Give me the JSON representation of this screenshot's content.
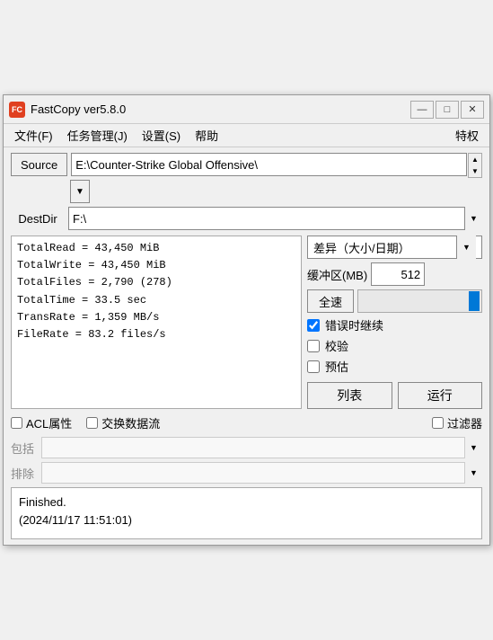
{
  "window": {
    "title": "FastCopy ver5.8.0",
    "icon_text": "FC",
    "min_btn": "—",
    "max_btn": "□",
    "close_btn": "✕"
  },
  "menu": {
    "file": "文件(F)",
    "task": "任务管理(J)",
    "settings": "设置(S)",
    "help": "帮助",
    "special": "特权"
  },
  "source": {
    "label": "Source",
    "path": "E:\\Counter-Strike Global Offensive\\",
    "scroll_up": "▲",
    "scroll_down": "▼",
    "dropdown_arrow": "▼"
  },
  "destdir": {
    "label": "DestDir",
    "path": "F:\\"
  },
  "stats": {
    "lines": [
      "TotalRead  = 43,450 MiB",
      "TotalWrite = 43,450 MiB",
      "TotalFiles = 2,790 (278)",
      "TotalTime  = 33.5 sec",
      "TransRate  = 1,359 MB/s",
      "FileRate   = 83.2 files/s"
    ]
  },
  "options": {
    "mode_label": "差异（大小/日期）",
    "mode_arrow": "▼",
    "buffer_label": "缓冲区(MB)",
    "buffer_value": "512",
    "speed_label": "全速",
    "continue_on_error_label": "错误时继续",
    "verify_label": "校验",
    "estimate_label": "预估"
  },
  "acl": {
    "acl_label": "ACL属性",
    "stream_label": "交换数据流"
  },
  "filter": {
    "include_label": "包括",
    "exclude_label": "排除",
    "filter_label": "过滤器"
  },
  "actions": {
    "list_label": "列表",
    "run_label": "运行"
  },
  "status": {
    "line1": "Finished.",
    "line2": "(2024/11/17 11:51:01)"
  }
}
